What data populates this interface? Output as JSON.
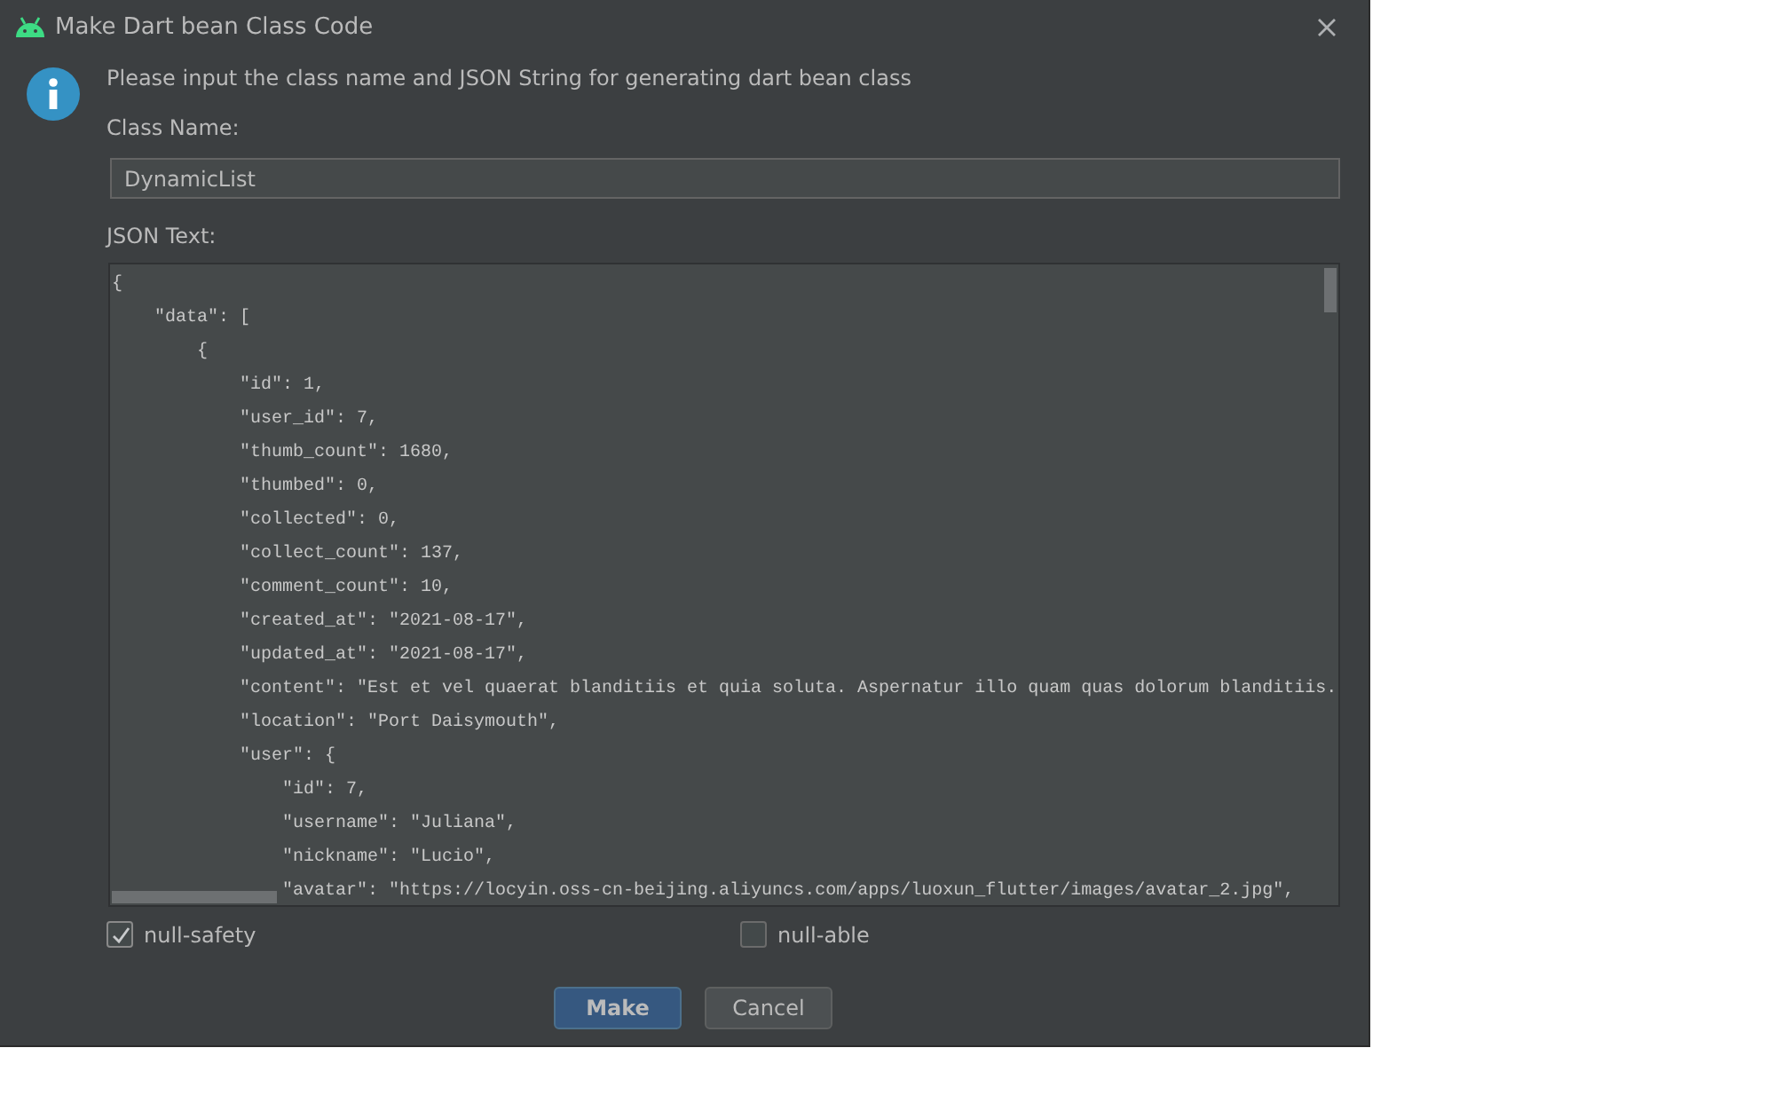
{
  "window": {
    "title": "Make Dart bean Class Code"
  },
  "message": "Please input the class name and JSON String for generating dart bean class",
  "class_name": {
    "label": "Class Name:",
    "value": "DynamicList"
  },
  "json_text": {
    "label": "JSON Text:",
    "lines": [
      "{",
      "    \"data\": [",
      "        {",
      "            \"id\": 1,",
      "            \"user_id\": 7,",
      "            \"thumb_count\": 1680,",
      "            \"thumbed\": 0,",
      "            \"collected\": 0,",
      "            \"collect_count\": 137,",
      "            \"comment_count\": 10,",
      "            \"created_at\": \"2021-08-17\",",
      "            \"updated_at\": \"2021-08-17\",",
      "            \"content\": \"Est et vel quaerat blanditiis et quia soluta. Aspernatur illo quam quas dolorum blanditiis.",
      "            \"location\": \"Port Daisymouth\",",
      "            \"user\": {",
      "                \"id\": 7,",
      "                \"username\": \"Juliana\",",
      "                \"nickname\": \"Lucio\",",
      "                \"avatar\": \"https://locyin.oss-cn-beijing.aliyuncs.com/apps/luoxun_flutter/images/avatar_2.jpg\","
    ]
  },
  "options": [
    {
      "label": "null-safety",
      "checked": true
    },
    {
      "label": "null-able",
      "checked": false
    }
  ],
  "buttons": [
    {
      "label": "Make",
      "kind": "primary"
    },
    {
      "label": "Cancel",
      "kind": "secondary"
    }
  ]
}
